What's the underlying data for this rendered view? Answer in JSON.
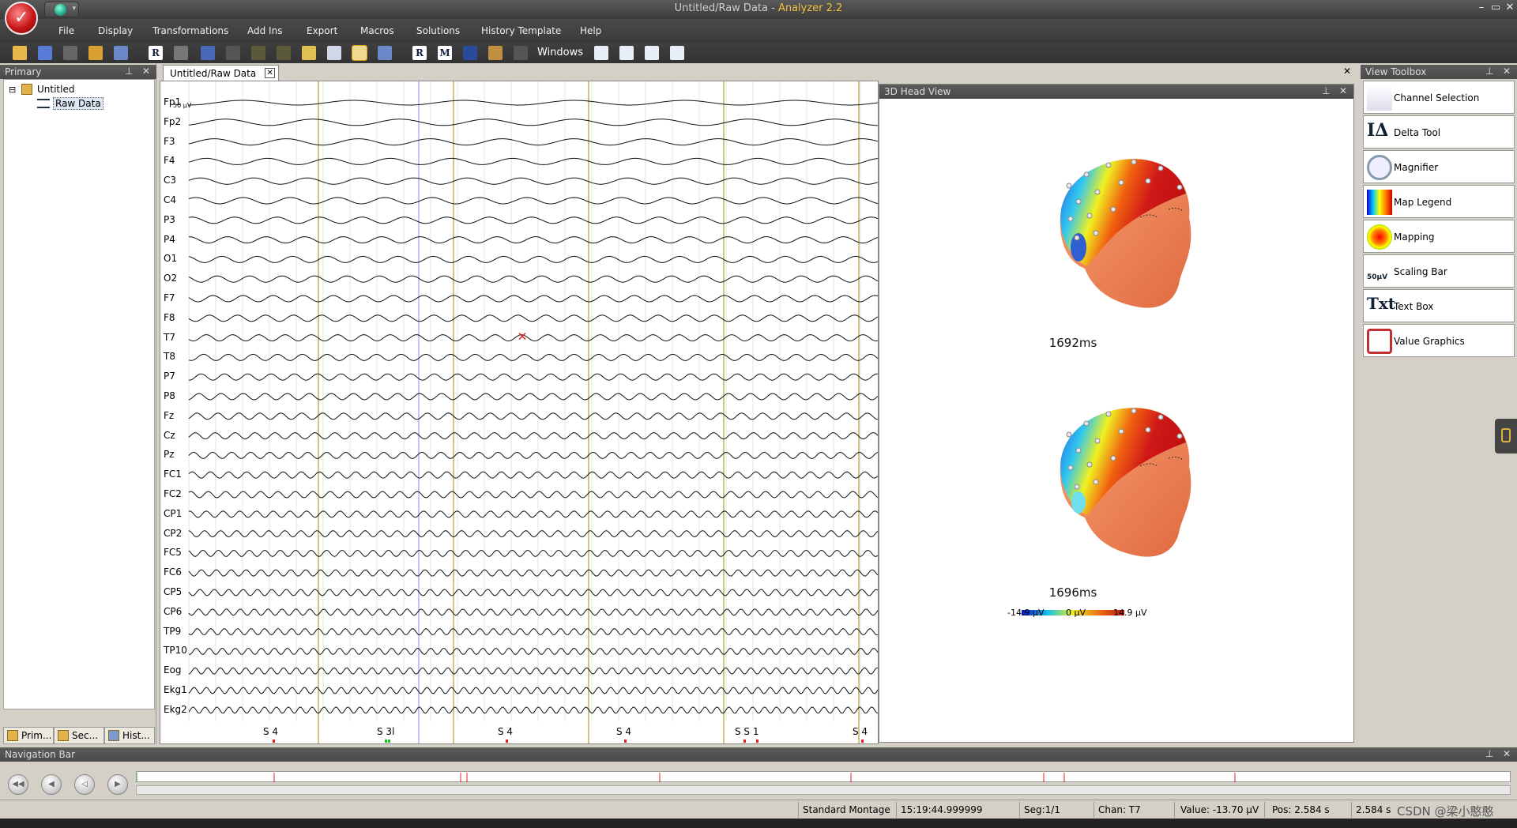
{
  "window": {
    "title_doc": "Untitled/Raw Data - ",
    "title_app": "Analyzer 2.2",
    "min": "–",
    "max": "▭",
    "close": "✕"
  },
  "menu": [
    "File",
    "Display",
    "Transformations",
    "Add Ins",
    "Export",
    "Macros",
    "Solutions",
    "History Template",
    "Help"
  ],
  "toolbar": {
    "windows_label": "Windows"
  },
  "primary": {
    "title": "Primary",
    "tree": {
      "root": "Untitled",
      "child": "Raw Data",
      "expander": "⊟"
    },
    "tabs": [
      "Prim...",
      "Sec...",
      "Hist..."
    ]
  },
  "document": {
    "tab_label": "Untitled/Raw Data",
    "scale_label": "50 µV",
    "channels": [
      "Fp1",
      "Fp2",
      "F3",
      "F4",
      "C3",
      "C4",
      "P3",
      "P4",
      "O1",
      "O2",
      "F7",
      "F8",
      "T7",
      "T8",
      "P7",
      "P8",
      "Fz",
      "Cz",
      "Pz",
      "FC1",
      "FC2",
      "CP1",
      "CP2",
      "FC5",
      "FC6",
      "CP5",
      "CP6",
      "TP9",
      "TP10",
      "Eog",
      "Ekg1",
      "Ekg2"
    ],
    "markers": [
      "S 4",
      "S 3l",
      "S 4",
      "S 4",
      "S  S 1",
      "S 4"
    ],
    "marker_colors": {
      "red": "#e02020",
      "green": "#20c020",
      "cursor": "#e02020"
    }
  },
  "headview": {
    "title": "3D Head View",
    "time1": "1692ms",
    "time2": "1696ms",
    "legend": {
      "min": "-14.9 µV",
      "mid": "0 µV",
      "max": "14.9 µV"
    }
  },
  "toolbox": {
    "title": "View Toolbox",
    "items": [
      "Channel Selection",
      "Delta Tool",
      "Magnifier",
      "Map Legend",
      "Mapping",
      "Scaling Bar",
      "Text Box",
      "Value Graphics"
    ]
  },
  "navbar": {
    "title": "Navigation Bar"
  },
  "status": {
    "montage": "Standard Montage",
    "time": "15:19:44.999999",
    "seg": "Seg:1/1",
    "chan": "Chan:  T7",
    "value": "Value: -13.70 µV",
    "pos": "Pos:  2.584 s",
    "pos2": "2.584 s",
    "watermark": "CSDN @梁小憨憨"
  },
  "colors": {
    "chrome": "#3c3c3c",
    "accent": "#f0c040"
  }
}
